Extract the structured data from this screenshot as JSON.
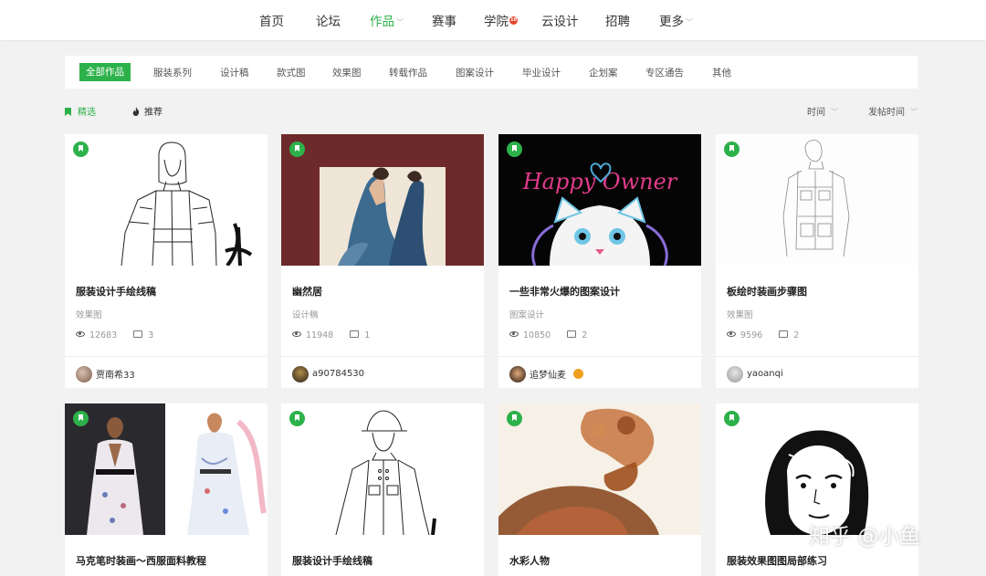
{
  "nav": {
    "items": [
      "首页",
      "论坛",
      "作品",
      "赛事",
      "学院",
      "云设计",
      "招聘",
      "更多"
    ],
    "active": "作品",
    "academy_badge": "10"
  },
  "categories": {
    "items": [
      "全部作品",
      "服装系列",
      "设计稿",
      "款式图",
      "效果图",
      "转载作品",
      "图案设计",
      "毕业设计",
      "企划案",
      "专区通告",
      "其他"
    ],
    "active": "全部作品"
  },
  "filters": {
    "featured": "精选",
    "recommended": "推荐",
    "sort_time": "时间",
    "sort_post_time": "发帖时间"
  },
  "cards": [
    {
      "title": "服装设计手绘线稿",
      "category": "效果图",
      "views": "12683",
      "comments": "3",
      "author": "贾南希33"
    },
    {
      "title": "幽然居",
      "category": "设计稿",
      "views": "11948",
      "comments": "1",
      "author": "a90784530"
    },
    {
      "title": "一些非常火爆的图案设计",
      "category": "图案设计",
      "views": "10850",
      "comments": "2",
      "author": "追梦仙麦"
    },
    {
      "title": "板绘时装画步骤图",
      "category": "效果图",
      "views": "9596",
      "comments": "2",
      "author": "yaoanqi"
    },
    {
      "title": "马克笔时装画～西服面料教程"
    },
    {
      "title": "服装设计手绘线稿"
    },
    {
      "title": "水彩人物"
    },
    {
      "title": "服装效果图图局部练习"
    }
  ],
  "thumb_text": {
    "happy_owner": "Happy Owner"
  },
  "watermark": "知乎 @小鱼",
  "colors": {
    "accent": "#2db14a",
    "badge": "#e8452e",
    "background": "#f2f2f2"
  }
}
